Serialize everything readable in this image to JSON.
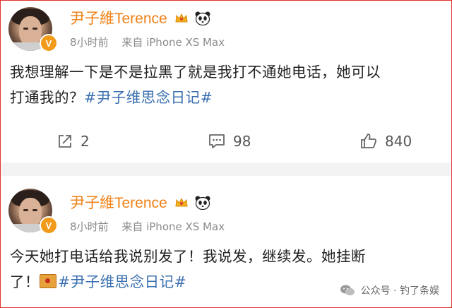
{
  "posts": [
    {
      "username": "尹子維Terence",
      "time": "8小时前",
      "source": "来自 iPhone XS Max",
      "text_lines": [
        "我想理解一下是不是拉黑了就是我打不通她电话，她可以",
        "打通我的？"
      ],
      "hashtag": "#尹子维思念日记#",
      "actions": {
        "share": "2",
        "comment": "98",
        "like": "840"
      }
    },
    {
      "username": "尹子維Terence",
      "time": "8小时前",
      "source": "来自 iPhone XS Max",
      "text_lines": [
        "今天她打电话给我说别发了！我说发，继续发。她挂断",
        "了！"
      ],
      "hashtag": "#尹子维思念日记#"
    }
  ],
  "watermark": {
    "label": "公众号 · 钓了条娱"
  },
  "colors": {
    "username": "#f08218",
    "hashtag": "#3a6fb0",
    "verified_badge": "#f29a1a",
    "frame_border": "#e0302a"
  },
  "icons": [
    "crown-icon",
    "panda-icon",
    "verified-badge-icon",
    "share-icon",
    "comment-icon",
    "like-icon",
    "wechat-icon",
    "envelope-emoji-icon"
  ]
}
